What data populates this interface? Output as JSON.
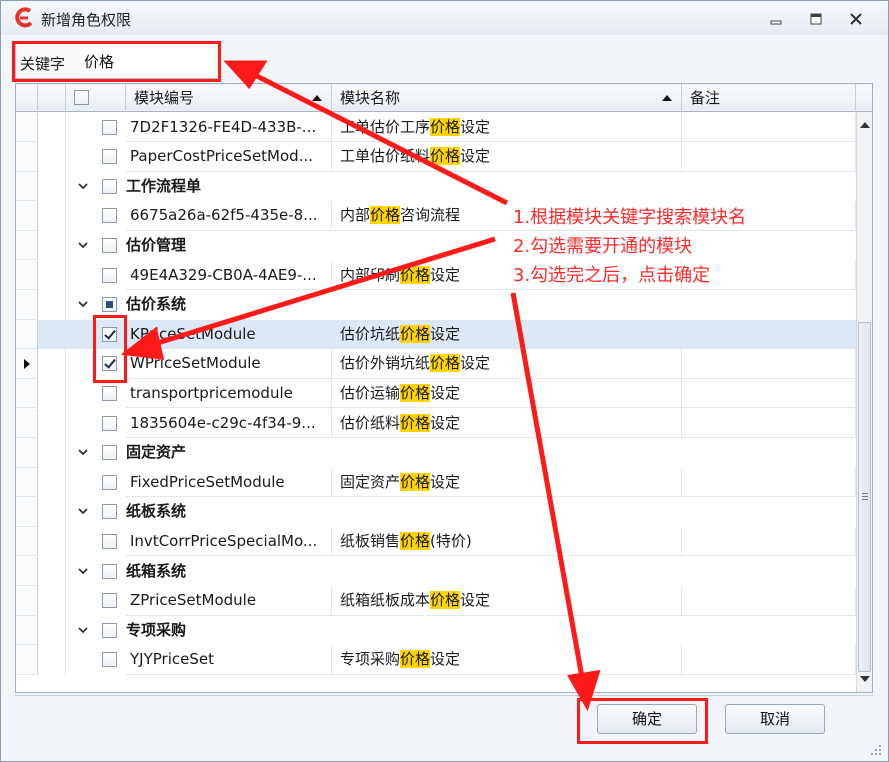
{
  "window": {
    "title": "新增角色权限",
    "accent": "#e8312b"
  },
  "search": {
    "label": "关键字",
    "value": "价格"
  },
  "table": {
    "headers": {
      "code": "模块编号",
      "name": "模块名称",
      "note": "备注"
    },
    "rows": [
      {
        "type": "item",
        "checked": false,
        "code": "7D2F1326-FE4D-433B-...",
        "name_pre": "工单估价工序",
        "name_hl": "价格",
        "name_post": "设定"
      },
      {
        "type": "item",
        "checked": false,
        "code": "PaperCostPriceSetMod...",
        "name_pre": "工单估价纸料",
        "name_hl": "价格",
        "name_post": "设定"
      },
      {
        "type": "group",
        "state": "unchecked",
        "label": "工作流程单"
      },
      {
        "type": "item",
        "checked": false,
        "code": "6675a26a-62f5-435e-8...",
        "name_pre": "内部",
        "name_hl": "价格",
        "name_post": "咨询流程"
      },
      {
        "type": "group",
        "state": "unchecked",
        "label": "估价管理"
      },
      {
        "type": "item",
        "checked": false,
        "code": "49E4A329-CB0A-4AE9-...",
        "name_pre": "内部印刷",
        "name_hl": "价格",
        "name_post": "设定"
      },
      {
        "type": "group",
        "state": "partial",
        "label": "估价系统"
      },
      {
        "type": "item",
        "checked": true,
        "selected": true,
        "code": "KPriceSetModule",
        "name_pre": "估价坑纸",
        "name_hl": "价格",
        "name_post": "设定"
      },
      {
        "type": "item",
        "checked": true,
        "current": true,
        "code": "WPriceSetModule",
        "name_pre": "估价外销坑纸",
        "name_hl": "价格",
        "name_post": "设定"
      },
      {
        "type": "item",
        "checked": false,
        "code": "transportpricemodule",
        "name_pre": "估价运输",
        "name_hl": "价格",
        "name_post": "设定"
      },
      {
        "type": "item",
        "checked": false,
        "code": "1835604e-c29c-4f34-9...",
        "name_pre": "估价纸料",
        "name_hl": "价格",
        "name_post": "设定"
      },
      {
        "type": "group",
        "state": "unchecked",
        "label": "固定资产"
      },
      {
        "type": "item",
        "checked": false,
        "code": "FixedPriceSetModule",
        "name_pre": "固定资产",
        "name_hl": "价格",
        "name_post": "设定"
      },
      {
        "type": "group",
        "state": "unchecked",
        "label": "纸板系统"
      },
      {
        "type": "item",
        "checked": false,
        "code": "InvtCorrPriceSpecialMo...",
        "name_pre": "纸板销售",
        "name_hl": "价格",
        "name_post": "(特价)"
      },
      {
        "type": "group",
        "state": "unchecked",
        "label": "纸箱系统"
      },
      {
        "type": "item",
        "checked": false,
        "code": "ZPriceSetModule",
        "name_pre": "纸箱纸板成本",
        "name_hl": "价格",
        "name_post": "设定"
      },
      {
        "type": "group",
        "state": "unchecked",
        "label": "专项采购"
      },
      {
        "type": "item",
        "checked": false,
        "code": "YJYPriceSet",
        "name_pre": "专项采购",
        "name_hl": "价格",
        "name_post": "设定"
      }
    ]
  },
  "buttons": {
    "ok": "确定",
    "cancel": "取消"
  },
  "annotations": {
    "step1": "1.根据模块关键字搜索模块名",
    "step2": "2.勾选需要开通的模块",
    "step3": "3.勾选完之后，点击确定",
    "color": "#ff1a1a"
  }
}
